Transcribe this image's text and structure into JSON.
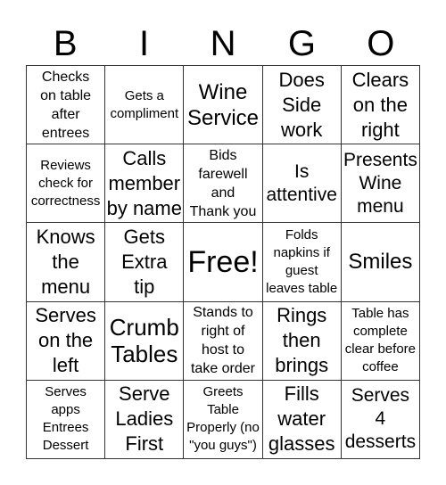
{
  "header": {
    "letters": [
      "B",
      "I",
      "N",
      "G",
      "O"
    ]
  },
  "cells": [
    [
      "Checks\non table\nafter\nentrees",
      "Gets a\ncompliment",
      "Wine\nService",
      "Does\nSide\nwork",
      "Clears\non the\nright"
    ],
    [
      "Reviews\ncheck for\ncorrectness",
      "Calls\nmember\nby name",
      "Bids\nfarewell\nand\nThank you",
      "Is\nattentive",
      "Presents\nWine\nmenu"
    ],
    [
      "Knows\nthe\nmenu",
      "Gets\nExtra\ntip",
      "Free!",
      "Folds\nnapkins if\nguest\nleaves table",
      "Smiles"
    ],
    [
      "Serves\non the\nleft",
      "Crumb\nTables",
      "Stands to\nright of\nhost to\ntake order",
      "Rings\nthen\nbrings",
      "Table has\ncomplete\nclear before\ncoffee"
    ],
    [
      "Serves\napps\nEntrees\nDessert",
      "Serve\nLadies\nFirst",
      "Greets\nTable\nProperly (no\n\"you guys\")",
      "Fills\nwater\nglasses",
      "Serves\n4\ndesserts"
    ]
  ]
}
